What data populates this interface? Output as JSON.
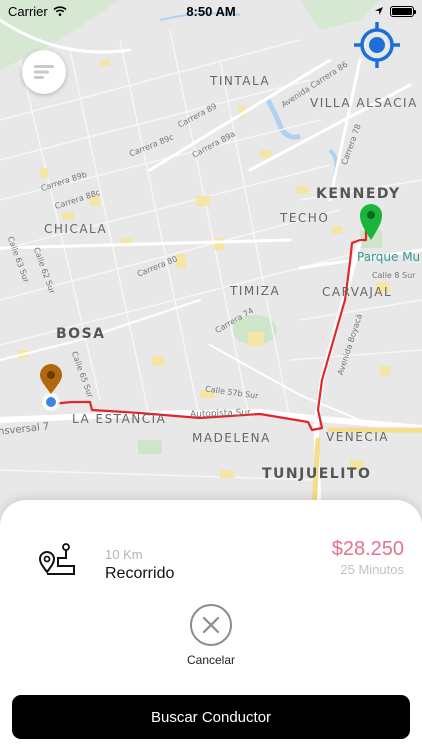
{
  "status_bar": {
    "carrier": "Carrier",
    "time": "8:50 AM"
  },
  "map": {
    "labels": {
      "tintala": "TINTALA",
      "villa_alsacia": "VILLA ALSACIA",
      "kennedy": "KENNEDY",
      "techo": "TECHO",
      "chicala": "CHICALA",
      "parque": "Parque Mu",
      "timiza": "TIMIZA",
      "carvajal": "CARVAJAL",
      "bosa": "BOSA",
      "la_estancia": "LA ESTANCIA",
      "madelena": "MADELENA",
      "venecia": "VENECIA",
      "tunjuelito": "TUNJUELITO",
      "autopista_sur": "Autopista Sur",
      "avenida_carrera_86": "Avenida Carrera 86",
      "avenida_boyaca": "Avenida Boyacá",
      "carrera_89": "Carrera 89",
      "carrera_89c": "Carrera 89c",
      "carrera_89a": "Carrera 89a",
      "carrera_89b": "Carrera 89b",
      "carrera_88c": "Carrera 88c",
      "carrera_80": "Carrera 80",
      "carrera_74": "Carrera 74",
      "carrera_78": "Carrera 78",
      "calle_8_sur": "Calle 8 Sur",
      "calle_57b_sur": "Calle 57b Sur",
      "calle_65_sur": "Calle 65 Sur",
      "calle_62_sur": "Calle 62 Sur",
      "calle_63_sur": "Calle 63 Sur",
      "transversal_7": "nsversal 7"
    },
    "route_color": "#e0262b",
    "origin_pin_color": "#b0670f",
    "destination_pin_color": "#1cb53b",
    "locate_color": "#1d6fd8"
  },
  "icons": {
    "menu": "menu-lines-icon",
    "locate": "crosshair-target-icon",
    "route": "route-map-pin-icon",
    "cancel": "close-x-icon"
  },
  "trip": {
    "distance": "10 Km",
    "label": "Recorrido",
    "price": "$28.250",
    "duration": "25 Minutos",
    "price_color": "#e8718f"
  },
  "actions": {
    "cancel_label": "Cancelar",
    "search_label": "Buscar Conductor"
  }
}
